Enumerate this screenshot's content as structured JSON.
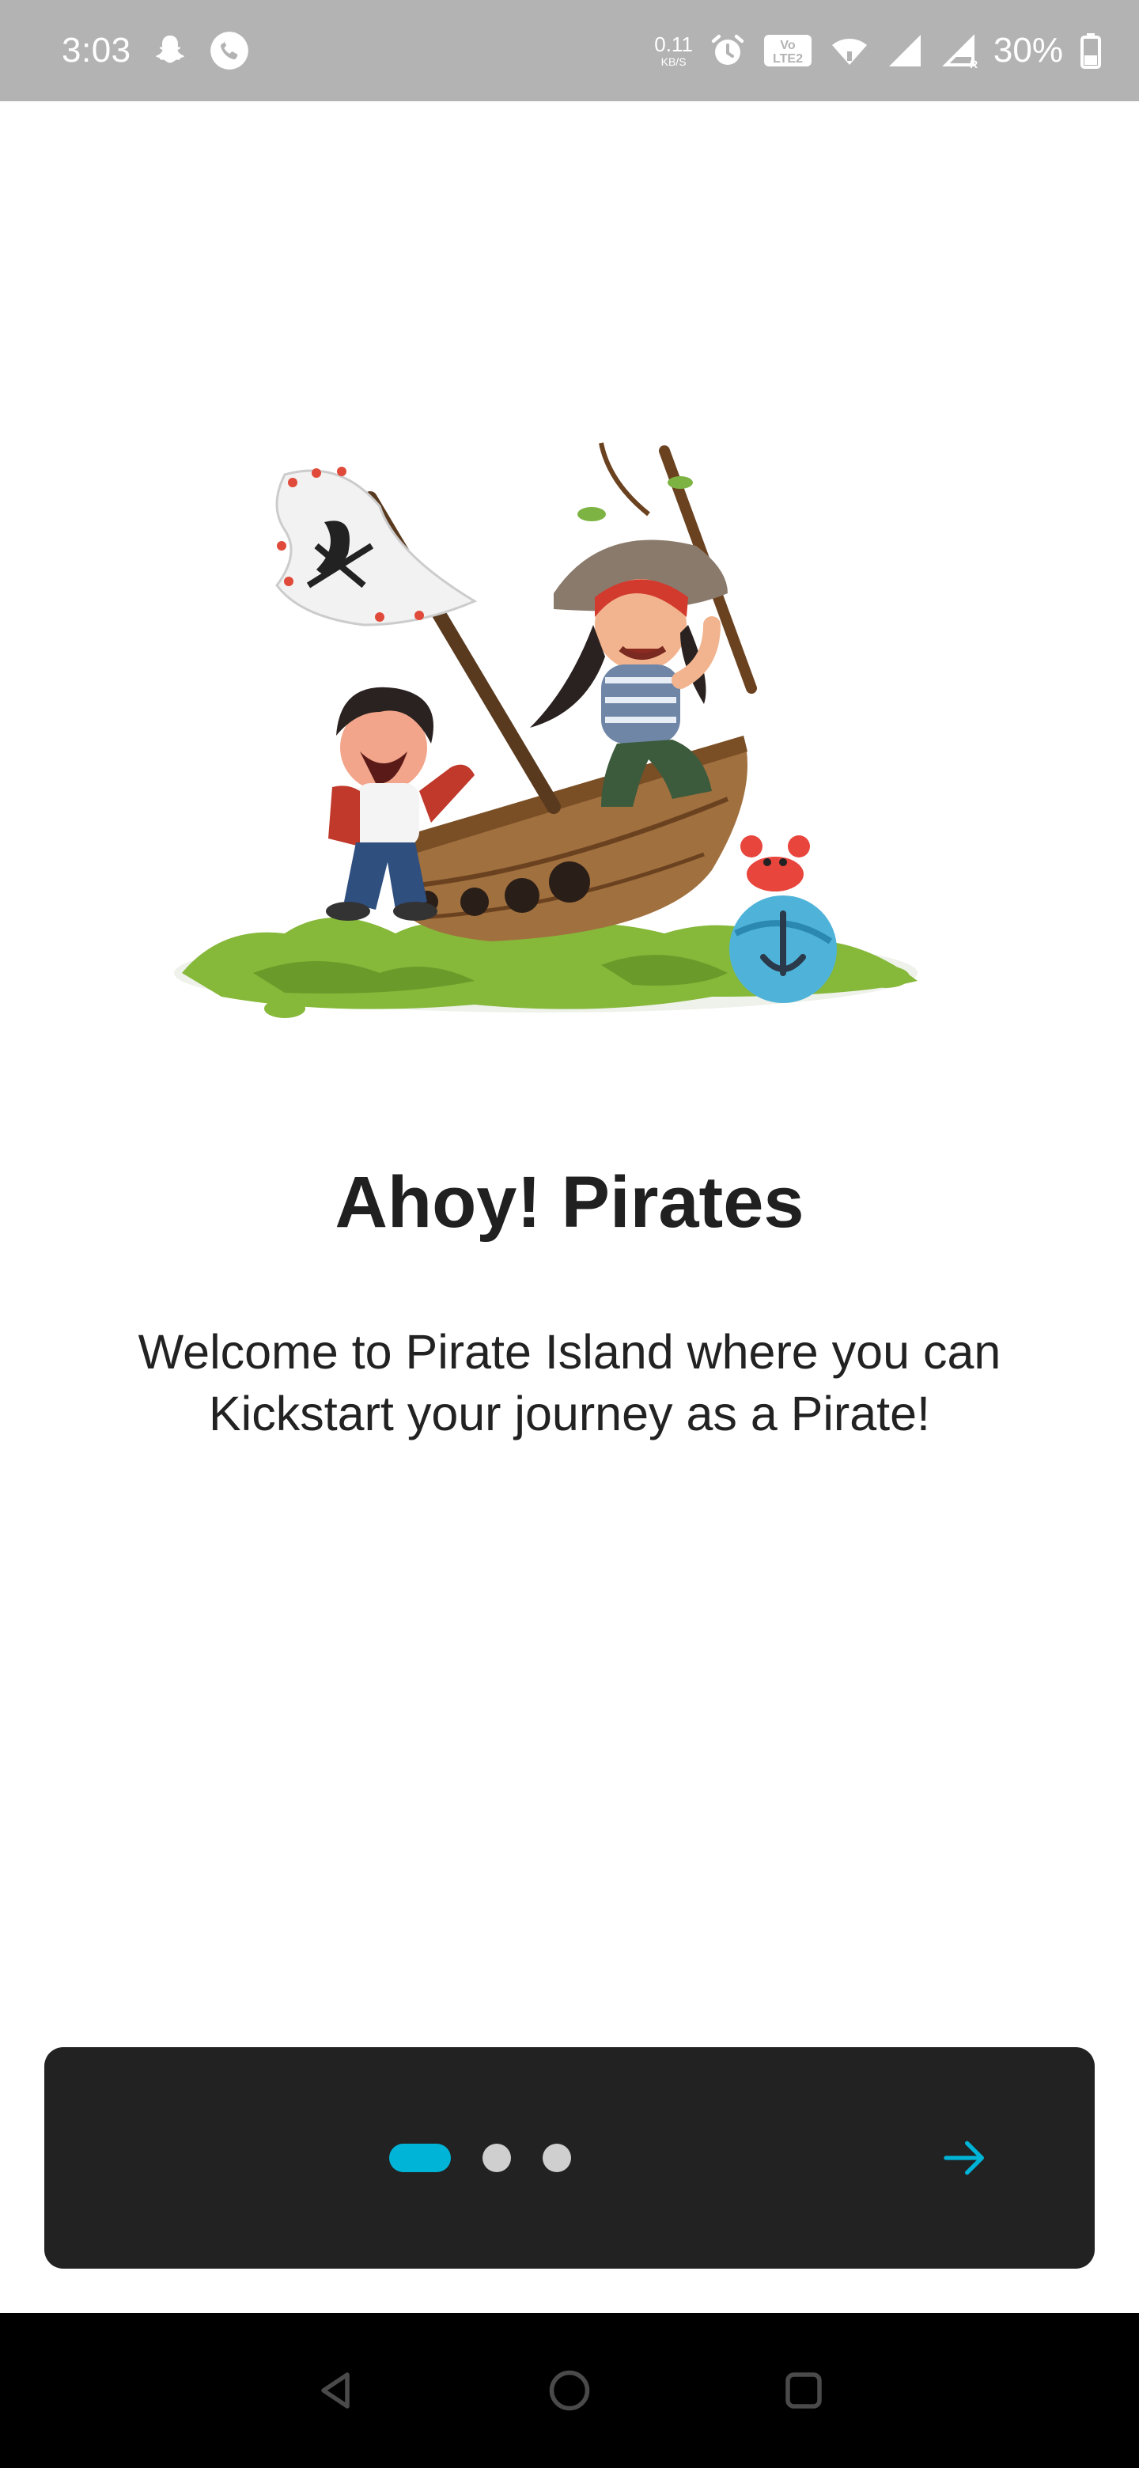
{
  "status_bar": {
    "time": "3:03",
    "net_speed_value": "0.11",
    "net_speed_unit": "KB/S",
    "volte_label": "Vo LTE2",
    "battery_percent": "30%",
    "icons": [
      "snapchat-icon",
      "phone-call-icon",
      "alarm-icon",
      "volte-icon",
      "wifi-icon",
      "signal-icon",
      "signal-roaming-icon",
      "battery-icon"
    ]
  },
  "onboarding": {
    "title": "Ahoy! Pirates",
    "description": "Welcome to Pirate Island where you can Kickstart your journey as a Pirate!",
    "illustration": "pirate-ship-illustration",
    "page_indicator": {
      "total": 3,
      "current": 1
    },
    "next_icon": "arrow-right-icon"
  },
  "colors": {
    "accent": "#00b4d8",
    "panel": "#222222",
    "status_bar": "#b3b3b3",
    "inactive_dot": "#cfcfcf"
  },
  "nav_bar": {
    "icons": [
      "back-triangle-icon",
      "home-circle-icon",
      "recents-square-icon"
    ]
  }
}
